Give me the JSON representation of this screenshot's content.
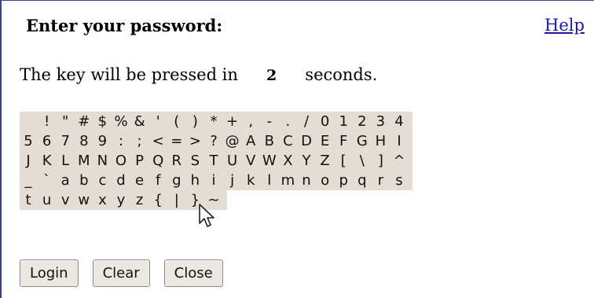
{
  "header": {
    "title": "Enter your password:",
    "help_link": "Help"
  },
  "countdown": {
    "prefix": "The key will be pressed in",
    "value": "2",
    "suffix": "seconds."
  },
  "keyboard": {
    "rows": [
      [
        " ",
        "!",
        "\"",
        "#",
        "$",
        "%",
        "&",
        "'",
        "(",
        ")",
        "*",
        "+",
        ",",
        "-",
        ".",
        "/",
        "0",
        "1",
        "2",
        "3",
        "4"
      ],
      [
        "5",
        "6",
        "7",
        "8",
        "9",
        ":",
        ";",
        "<",
        "=",
        ">",
        "?",
        "@",
        "A",
        "B",
        "C",
        "D",
        "E",
        "F",
        "G",
        "H",
        "I"
      ],
      [
        "J",
        "K",
        "L",
        "M",
        "N",
        "O",
        "P",
        "Q",
        "R",
        "S",
        "T",
        "U",
        "V",
        "W",
        "X",
        "Y",
        "Z",
        "[",
        "\\",
        "]",
        "^"
      ],
      [
        "_",
        "`",
        "a",
        "b",
        "c",
        "d",
        "e",
        "f",
        "g",
        "h",
        "i",
        "j",
        "k",
        "l",
        "m",
        "n",
        "o",
        "p",
        "q",
        "r",
        "s"
      ],
      [
        "t",
        "u",
        "v",
        "w",
        "x",
        "y",
        "z",
        "{",
        "|",
        "}",
        "~"
      ]
    ]
  },
  "buttons": {
    "login": "Login",
    "clear": "Clear",
    "close": "Close"
  },
  "colors": {
    "key_background": "#e5ddd4",
    "link": "#1a1aa6",
    "frame_border": "#3a3f8f"
  }
}
